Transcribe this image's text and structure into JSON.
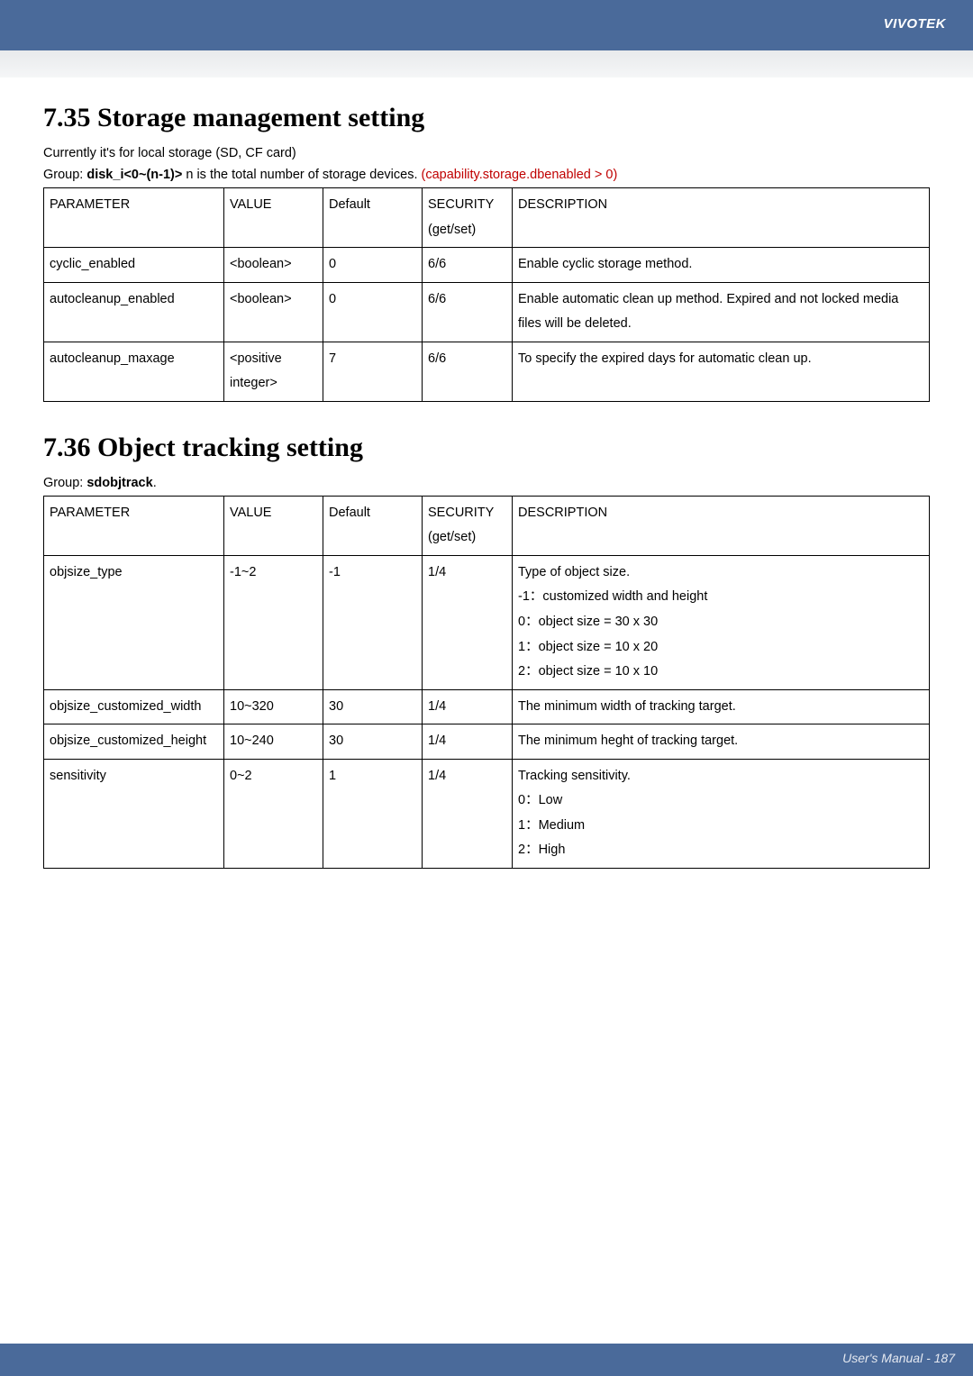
{
  "brand": "VIVOTEK",
  "footer": "User's Manual - 187",
  "section1": {
    "title": "7.35 Storage management setting",
    "note": "Currently it's for local storage (SD, CF card)",
    "group_prefix": "Group: ",
    "group_bold": "disk_i<0~(n-1)>",
    "group_rest": " n is the total number of storage devices. ",
    "group_red": "(capability.storage.dbenabled > 0)",
    "headers": {
      "param": "PARAMETER",
      "value": "VALUE",
      "default": "Default",
      "security1": "SECURITY",
      "security2": "(get/set)",
      "desc": "DESCRIPTION"
    },
    "rows": [
      {
        "param": "cyclic_enabled",
        "value": "<boolean>",
        "default": "0",
        "security": "6/6",
        "desc": "Enable cyclic storage method."
      },
      {
        "param": "autocleanup_enabled",
        "value": "<boolean>",
        "default": "0",
        "security": "6/6",
        "desc": "Enable automatic clean up method. Expired and not locked media files will be deleted."
      },
      {
        "param": "autocleanup_maxage",
        "value": "<positive integer>",
        "default": "7",
        "security": "6/6",
        "desc": "To specify the expired days for automatic clean up."
      }
    ]
  },
  "section2": {
    "title": "7.36 Object tracking setting",
    "group_prefix": "Group: ",
    "group_bold": "sdobjtrack",
    "group_suffix": ".",
    "headers": {
      "param": "PARAMETER",
      "value": "VALUE",
      "default": "Default",
      "security1": "SECURITY",
      "security2": "(get/set)",
      "desc": "DESCRIPTION"
    },
    "rows": [
      {
        "param": "objsize_type",
        "value": "-1~2",
        "default": "-1",
        "security": "1/4",
        "desc_lines": [
          "Type of object size.",
          "-1：customized width and height",
          " 0：object size = 30 x 30",
          " 1：object size = 10 x 20",
          " 2：object size = 10 x 10"
        ]
      },
      {
        "param": "objsize_customized_width",
        "value": "10~320",
        "default": "30",
        "security": "1/4",
        "desc_lines": [
          "The minimum width of tracking target."
        ]
      },
      {
        "param": "objsize_customized_height",
        "value": "10~240",
        "default": "30",
        "security": "1/4",
        "desc_lines": [
          "The minimum heght of tracking target."
        ]
      },
      {
        "param": "sensitivity",
        "value": "0~2",
        "default": "1",
        "security": "1/4",
        "desc_lines": [
          "Tracking sensitivity.",
          "0：Low",
          "1：Medium",
          "2：High"
        ]
      }
    ]
  }
}
